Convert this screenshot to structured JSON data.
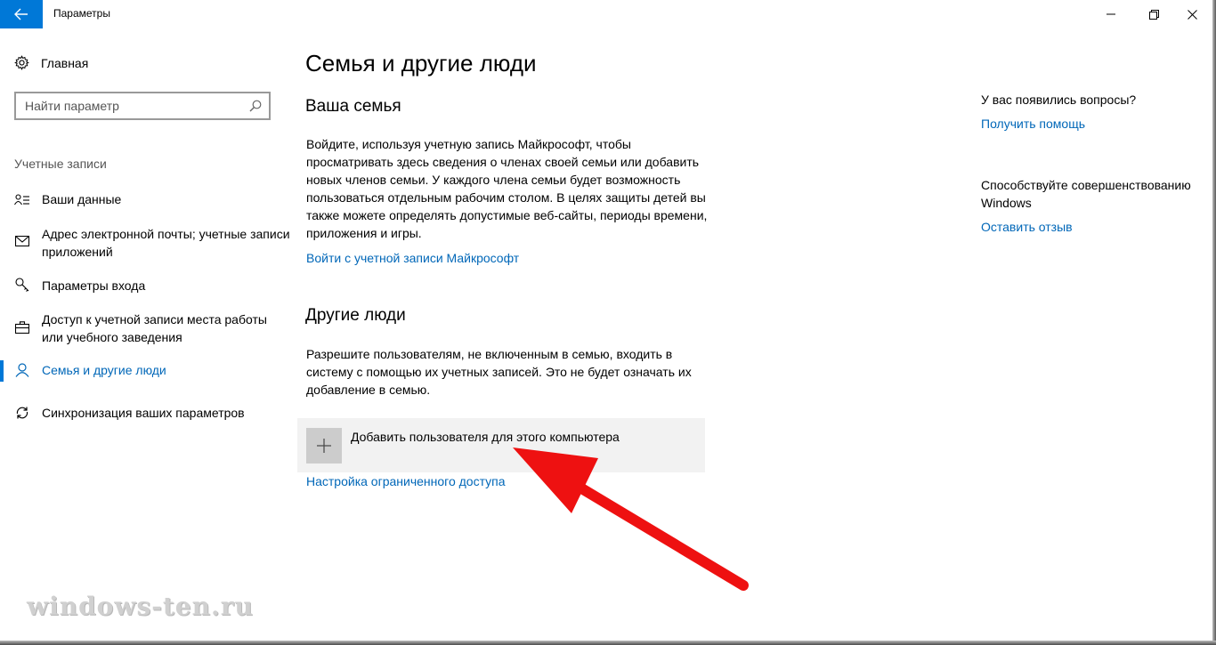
{
  "window": {
    "title": "Параметры"
  },
  "sidebar": {
    "home_label": "Главная",
    "search_placeholder": "Найти параметр",
    "section_label": "Учетные записи",
    "items": [
      {
        "label": "Ваши данные",
        "icon": "person-card-icon"
      },
      {
        "label": "Адрес электронной почты; учетные записи приложений",
        "icon": "mail-icon"
      },
      {
        "label": "Параметры входа",
        "icon": "key-icon"
      },
      {
        "label": "Доступ к учетной записи места работы или учебного заведения",
        "icon": "briefcase-icon"
      },
      {
        "label": "Семья и другие люди",
        "icon": "person-icon",
        "active": true
      },
      {
        "label": "Синхронизация ваших параметров",
        "icon": "sync-icon"
      }
    ]
  },
  "main": {
    "title": "Семья и другие люди",
    "family": {
      "heading": "Ваша семья",
      "text": "Войдите, используя учетную запись Майкрософт, чтобы просматривать здесь сведения о членах своей семьи или добавить новых членов семьи. У каждого члена семьи будет возможность пользоваться отдельным рабочим столом. В целях защиты детей вы также можете определять допустимые веб-сайты, периоды времени, приложения и игры.",
      "link": "Войти с учетной записи Майкрософт"
    },
    "others": {
      "heading": "Другие люди",
      "text": "Разрешите пользователям, не включенным в семью, входить в систему с помощью их учетных записей. Это не будет означать их добавление в семью.",
      "add_label": "Добавить пользователя для этого компьютера",
      "kiosk_link": "Настройка ограниченного доступа"
    }
  },
  "right_panel": {
    "question": "У вас появились вопросы?",
    "help_link": "Получить помощь",
    "improve_text": "Способствуйте совершенствованию Windows",
    "feedback_link": "Оставить отзыв"
  },
  "watermark": "windows-ten.ru",
  "colors": {
    "accent": "#0078d7",
    "link": "#0067b8",
    "arrow": "#ee1111"
  }
}
